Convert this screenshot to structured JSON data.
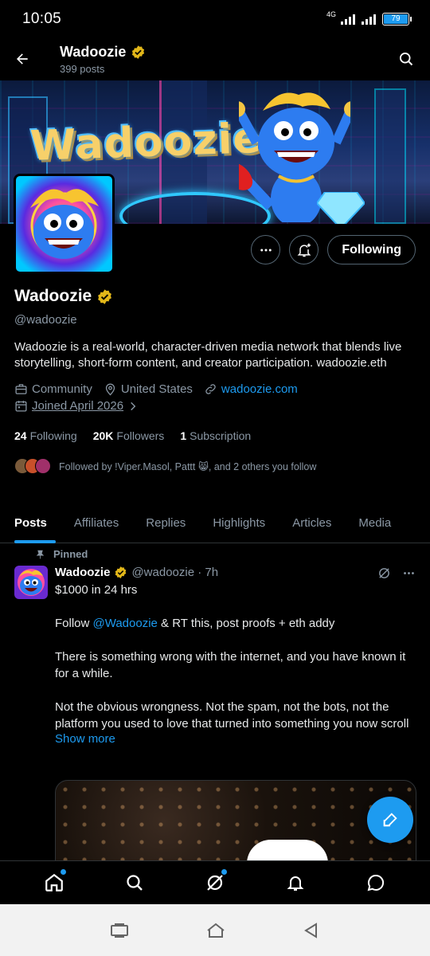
{
  "status_bar": {
    "time": "10:05",
    "network": "4G",
    "battery": "79"
  },
  "header": {
    "title": "Wadoozie",
    "post_count": "399 posts"
  },
  "banner": {
    "wordmark": "Wadoozie"
  },
  "actions": {
    "follow_label": "Following"
  },
  "profile": {
    "name": "Wadoozie",
    "handle": "@wadoozie",
    "bio": "Wadoozie is a real-world, character-driven media network that blends live storytelling, short-form content, and creator participation. wadoozie.eth",
    "category": "Community",
    "location": "United States",
    "website": "wadoozie.com",
    "joined": "Joined April 2026",
    "following_count": "24",
    "following_label": "Following",
    "followers_count": "20K",
    "followers_label": "Followers",
    "subscription_count": "1",
    "subscription_label": "Subscription",
    "followed_by": "Followed by !Viper.Masol, Pattt 😸, and 2 others you follow"
  },
  "tabs": [
    "Posts",
    "Affiliates",
    "Replies",
    "Highlights",
    "Articles",
    "Media"
  ],
  "post": {
    "pinned_label": "Pinned",
    "author": "Wadoozie",
    "handle_time": "@wadoozie · 7h",
    "line1": "$1000 in 24 hrs",
    "line2_prefix": "Follow ",
    "line2_mention": "@Wadoozie",
    "line2_suffix": " & RT this, post proofs + eth addy",
    "line3": "There is something wrong with the internet, and you have known it for a while.",
    "line4": "Not the obvious wrongness. Not the spam, not the bots, not the platform you used to love that turned into something you now scroll",
    "show_more": "Show more"
  },
  "colors": {
    "accent": "#1d9bf0",
    "verified": "#e2b719",
    "background": "#000000"
  },
  "icons": {
    "back": "arrow-left-icon",
    "search": "search-icon",
    "verified": "verified-badge-icon",
    "more": "more-icon",
    "notify": "bell-plus-icon",
    "community": "briefcase-icon",
    "location": "location-pin-icon",
    "link": "link-icon",
    "calendar": "calendar-icon",
    "pin": "pin-icon",
    "grok": "grok-icon",
    "compose": "compose-icon",
    "nav": [
      "home-icon",
      "search-icon",
      "grok-icon",
      "bell-icon",
      "message-icon"
    ]
  }
}
